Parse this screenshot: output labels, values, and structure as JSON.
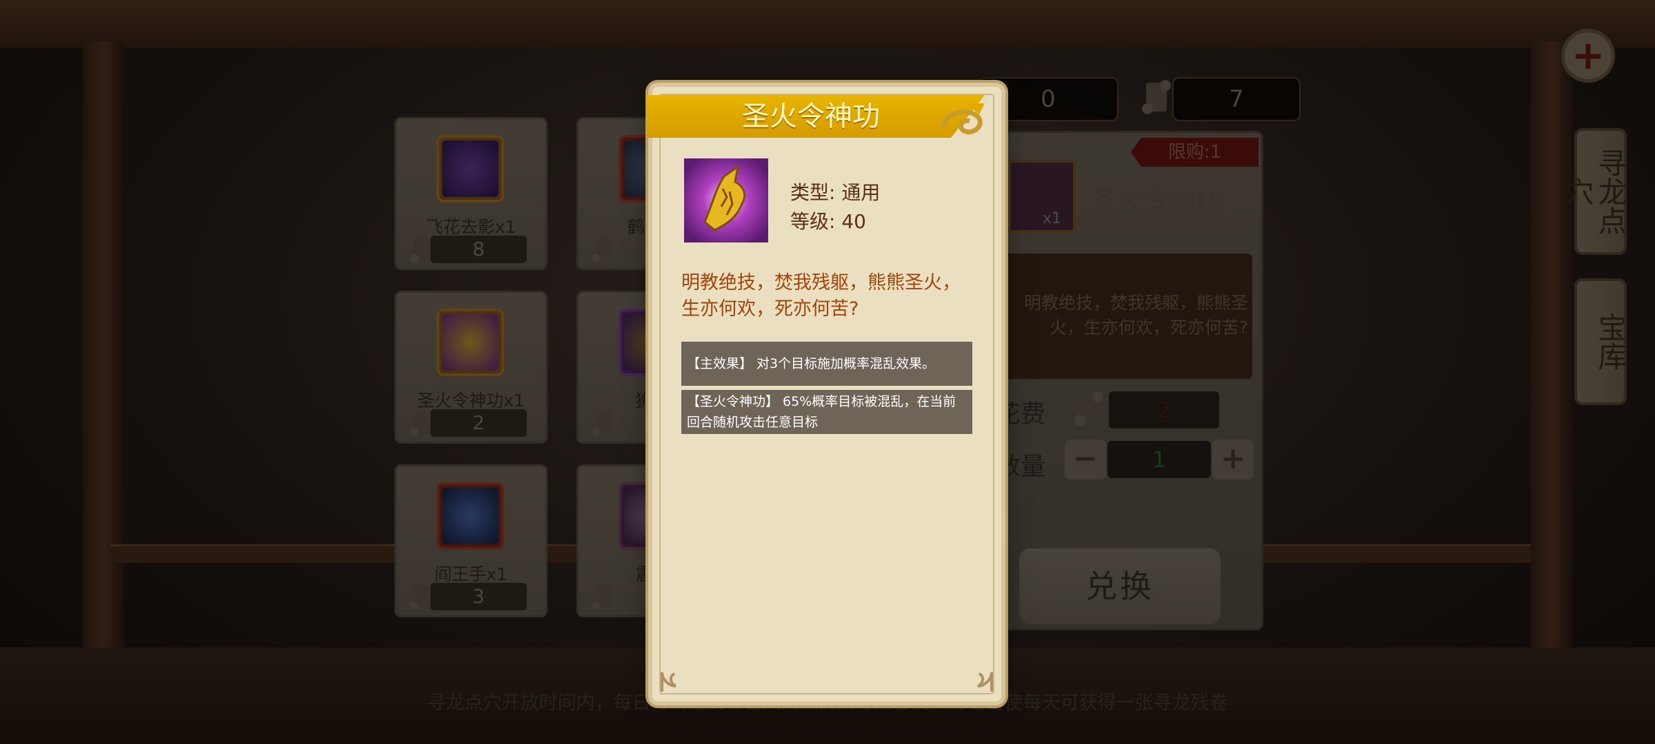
{
  "currency": {
    "first_value": "0",
    "second_value": "7"
  },
  "items": [
    {
      "name": "飞花去影x1",
      "cost": "8"
    },
    {
      "name": "鹤唳九",
      "cost": ""
    },
    {
      "name": "圣火令神功x1",
      "cost": "2"
    },
    {
      "name": "狮子",
      "cost": ""
    },
    {
      "name": "阎王手x1",
      "cost": "3"
    },
    {
      "name": "震天",
      "cost": ""
    }
  ],
  "detail_panel": {
    "limit_label": "限购:1",
    "item_title": "圣火令神功",
    "item_qty": "x1",
    "desc": "明教绝技，焚我残躯，熊熊圣火，生亦何欢，死亦何苦?",
    "cost_label": "花费",
    "cost_value": "2",
    "quantity_label": "数量",
    "quantity_value": "1",
    "minus": "−",
    "plus": "+",
    "exchange_label": "兑换"
  },
  "side_tabs": {
    "plus": "+",
    "tab1": "寻龙点穴",
    "tab2": "宝库"
  },
  "footer": "寻龙点穴开放时间内，每日可前往武林各大门派挑战寻龙密使，每位密使每天可获得一张寻龙残卷",
  "modal": {
    "title": "圣火令神功",
    "type_line": "类型: 通用",
    "level_line": "等级: 40",
    "description": "明教绝技，焚我残躯，熊熊圣火，生亦何欢，死亦何苦?",
    "main_effect": "【主效果】 对3个目标施加概率混乱效果。",
    "skill_effect": "【圣火令神功】 65%概率目标被混乱，在当前回合随机攻击任意目标"
  },
  "colors": {
    "title_bar": "#e0aa00",
    "modal_bg": "#eadfc0",
    "desc_text": "#a0460a",
    "effect_box": "#6e6458"
  },
  "icons": [
    "plus-icon",
    "scroll-icon",
    "flame-token-icon",
    "curl-ornament-icon"
  ]
}
